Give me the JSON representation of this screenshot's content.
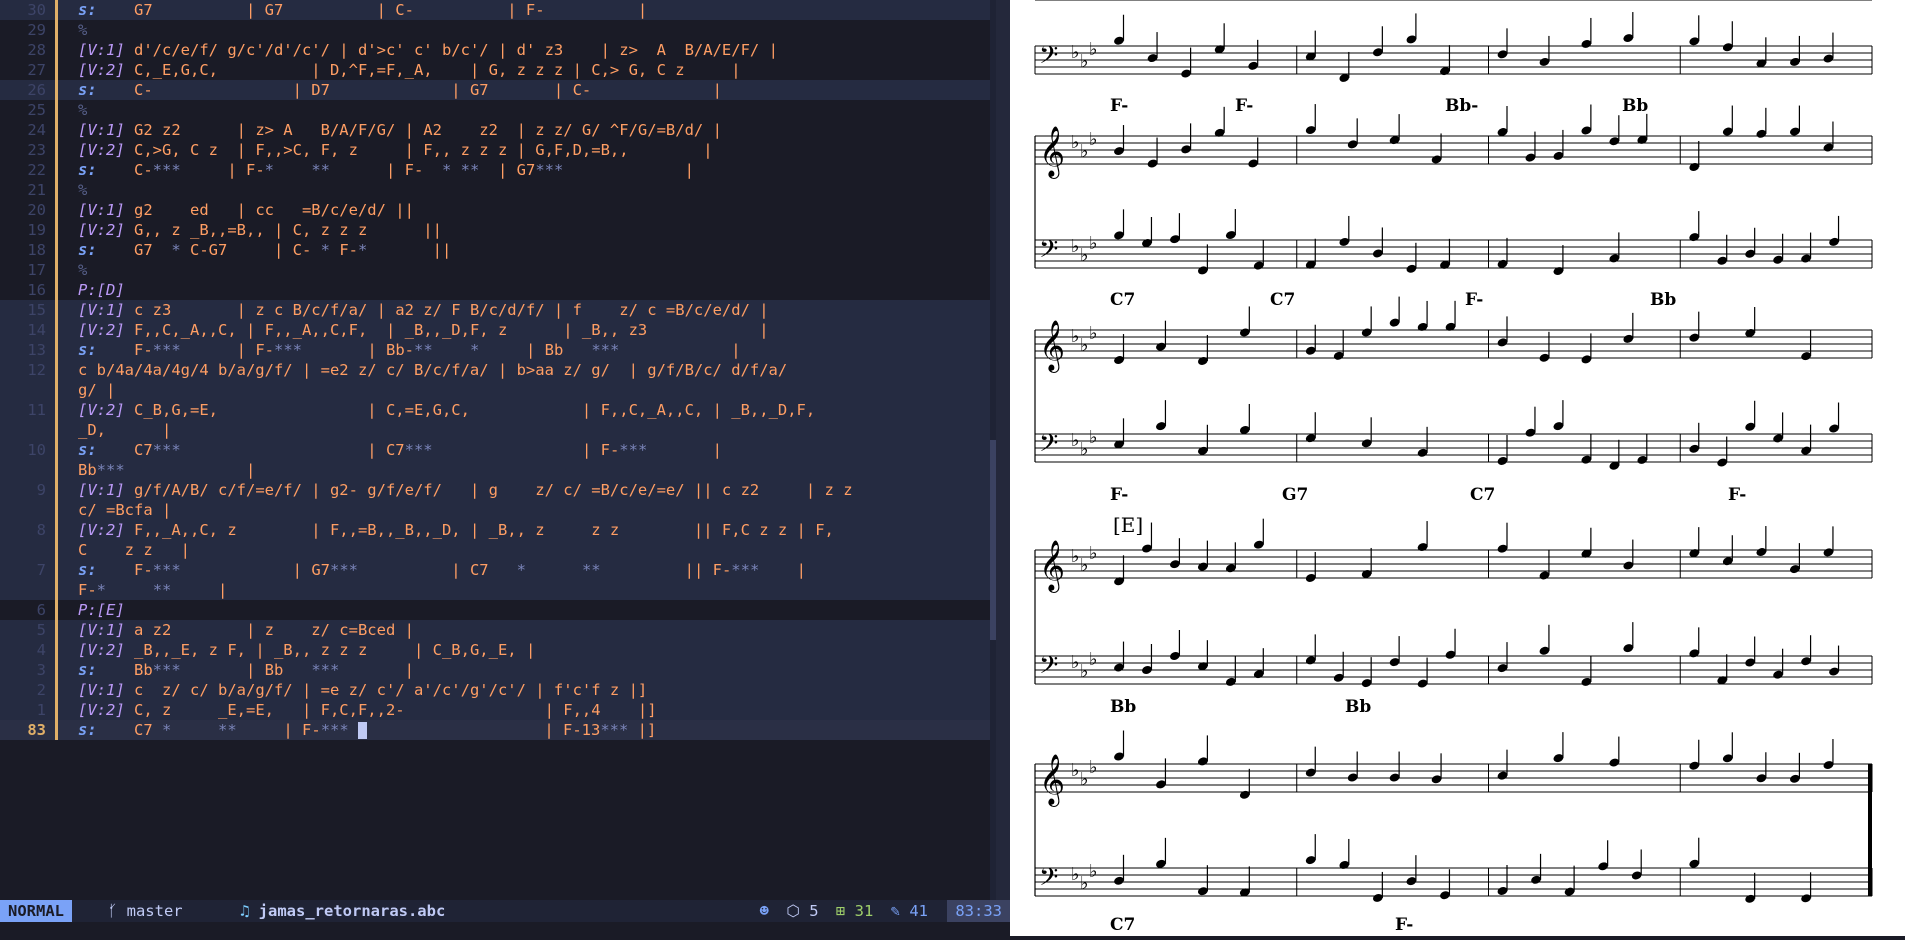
{
  "editor": {
    "lines": [
      {
        "num": "30",
        "hl": true,
        "parts": [
          [
            "s",
            "s:"
          ],
          [
            "n",
            "    G7          | G7          | C-          | F-          |"
          ]
        ]
      },
      {
        "num": "29",
        "hl": false,
        "parts": [
          [
            "c",
            "%"
          ]
        ]
      },
      {
        "num": "28",
        "hl": false,
        "parts": [
          [
            "v",
            "[V:1]"
          ],
          [
            "n",
            " d'/c/e/f/ g/c'/d'/c'/ | d'>c' c' b/c'/ | d' z3    | z>  A  B/A/E/F/ |"
          ]
        ]
      },
      {
        "num": "27",
        "hl": false,
        "parts": [
          [
            "v",
            "[V:2]"
          ],
          [
            "n",
            " C,_E,G,C,          | D,^F,=F,_A,    | G, z z z | C,> G, C z     |"
          ]
        ]
      },
      {
        "num": "26",
        "hl": true,
        "parts": [
          [
            "s",
            "s:"
          ],
          [
            "n",
            "    C-               | D7             | G7       | C-             |"
          ]
        ]
      },
      {
        "num": "25",
        "hl": false,
        "parts": [
          [
            "c",
            "%"
          ]
        ]
      },
      {
        "num": "24",
        "hl": false,
        "parts": [
          [
            "v",
            "[V:1]"
          ],
          [
            "n",
            " G2 z2      | z> A   B/A/F/G/ | A2    z2  | z z/ G/ ^F/G/=B/d/ |"
          ]
        ]
      },
      {
        "num": "23",
        "hl": false,
        "parts": [
          [
            "v",
            "[V:2]"
          ],
          [
            "n",
            " C,>G, C z  | F,,>C, F, z     | F,, z z z | G,F,D,=B,,        |"
          ]
        ]
      },
      {
        "num": "22",
        "hl": false,
        "parts": [
          [
            "s",
            "s:"
          ],
          [
            "n",
            "    C-"
          ],
          [
            "x",
            "***"
          ],
          [
            "n",
            "     | F-"
          ],
          [
            "x",
            "*"
          ],
          [
            "n",
            "    "
          ],
          [
            "x",
            "**"
          ],
          [
            "n",
            "      | F-  "
          ],
          [
            "x",
            "* **"
          ],
          [
            "n",
            "  | G7"
          ],
          [
            "x",
            "***"
          ],
          [
            "n",
            "             |"
          ]
        ]
      },
      {
        "num": "21",
        "hl": false,
        "parts": [
          [
            "c",
            "%"
          ]
        ]
      },
      {
        "num": "20",
        "hl": false,
        "parts": [
          [
            "v",
            "[V:1]"
          ],
          [
            "n",
            " g2    ed   | cc   =B/c/e/d/ ||"
          ]
        ]
      },
      {
        "num": "19",
        "hl": false,
        "parts": [
          [
            "v",
            "[V:2]"
          ],
          [
            "n",
            " G,, z _B,,=B,, | C, z z z      ||"
          ]
        ]
      },
      {
        "num": "18",
        "hl": false,
        "parts": [
          [
            "s",
            "s:"
          ],
          [
            "n",
            "    G7  "
          ],
          [
            "x",
            "*"
          ],
          [
            "n",
            " C-G7     | C- "
          ],
          [
            "x",
            "*"
          ],
          [
            "n",
            " F-"
          ],
          [
            "x",
            "*"
          ],
          [
            "n",
            "       ||"
          ]
        ]
      },
      {
        "num": "17",
        "hl": false,
        "parts": [
          [
            "c",
            "%"
          ]
        ]
      },
      {
        "num": "16",
        "hl": false,
        "parts": [
          [
            "p",
            "P:[D]"
          ]
        ]
      },
      {
        "num": "15",
        "hl": true,
        "parts": [
          [
            "v",
            "[V:1]"
          ],
          [
            "n",
            " c z3       | z c B/c/f/a/ | a2 z/ F B/c/d/f/ | f    z/ c =B/c/e/d/ |"
          ]
        ]
      },
      {
        "num": "14",
        "hl": true,
        "parts": [
          [
            "v",
            "[V:2]"
          ],
          [
            "n",
            " F,,C,_A,,C, | F,,_A,,C,F,  | _B,,_D,F, z      | _B,, z3            |"
          ]
        ]
      },
      {
        "num": "13",
        "hl": true,
        "parts": [
          [
            "s",
            "s:"
          ],
          [
            "n",
            "    F-"
          ],
          [
            "x",
            "***"
          ],
          [
            "n",
            "      | F-"
          ],
          [
            "x",
            "***"
          ],
          [
            "n",
            "       | Bb-"
          ],
          [
            "x",
            "**"
          ],
          [
            "n",
            "    "
          ],
          [
            "x",
            "*"
          ],
          [
            "n",
            "     | Bb   "
          ],
          [
            "x",
            "***"
          ],
          [
            "n",
            "            |"
          ]
        ]
      },
      {
        "num": "12",
        "hl": true,
        "parts": [
          [
            "n",
            "c b/4a/4a/4g/4 b/a/g/f/ | =e2 z/ c/ B/c/f/a/ | b>aa z/ g/  | g/f/B/c/ d/f/a/"
          ]
        ]
      },
      {
        "num": "",
        "hl": true,
        "parts": [
          [
            "n",
            "g/ |"
          ]
        ]
      },
      {
        "num": "11",
        "hl": true,
        "parts": [
          [
            "v",
            "[V:2]"
          ],
          [
            "n",
            " C_B,G,=E,                | C,=E,G,C,            | F,,C,_A,,C, | _B,,_D,F,"
          ]
        ]
      },
      {
        "num": "",
        "hl": true,
        "parts": [
          [
            "n",
            "_D,      |"
          ]
        ]
      },
      {
        "num": "10",
        "hl": true,
        "parts": [
          [
            "s",
            "s:"
          ],
          [
            "n",
            "    C7"
          ],
          [
            "x",
            "***"
          ],
          [
            "n",
            "                    | C7"
          ],
          [
            "x",
            "***"
          ],
          [
            "n",
            "                | F-"
          ],
          [
            "x",
            "***"
          ],
          [
            "n",
            "       |"
          ]
        ]
      },
      {
        "num": "",
        "hl": true,
        "parts": [
          [
            "n",
            "Bb"
          ],
          [
            "x",
            "***"
          ],
          [
            "n",
            "             |"
          ]
        ]
      },
      {
        "num": "9",
        "hl": true,
        "parts": [
          [
            "v",
            "[V:1]"
          ],
          [
            "n",
            " g/f/A/B/ c/f/=e/f/ | g2- g/f/e/f/   | g    z/ c/ =B/c/e/=e/ || c z2     | z z"
          ]
        ]
      },
      {
        "num": "",
        "hl": true,
        "parts": [
          [
            "n",
            "c/ =Bcfa |"
          ]
        ]
      },
      {
        "num": "8",
        "hl": true,
        "parts": [
          [
            "v",
            "[V:2]"
          ],
          [
            "n",
            " F,,_A,,C, z        | F,,=B,,_B,,_D, | _B,, z     z z        || F,C z z | F,"
          ]
        ]
      },
      {
        "num": "",
        "hl": true,
        "parts": [
          [
            "n",
            "C    z z   |"
          ]
        ]
      },
      {
        "num": "7",
        "hl": true,
        "parts": [
          [
            "s",
            "s:"
          ],
          [
            "n",
            "    F-"
          ],
          [
            "x",
            "***"
          ],
          [
            "n",
            "            | G7"
          ],
          [
            "x",
            "***"
          ],
          [
            "n",
            "          | C7   "
          ],
          [
            "x",
            "*"
          ],
          [
            "n",
            "      "
          ],
          [
            "x",
            "**"
          ],
          [
            "n",
            "         || F-"
          ],
          [
            "x",
            "***"
          ],
          [
            "n",
            "    |"
          ]
        ]
      },
      {
        "num": "",
        "hl": true,
        "parts": [
          [
            "n",
            "F-"
          ],
          [
            "x",
            "*"
          ],
          [
            "n",
            "     "
          ],
          [
            "x",
            "**"
          ],
          [
            "n",
            "     |"
          ]
        ]
      },
      {
        "num": "6",
        "hl": false,
        "parts": [
          [
            "p",
            "P:[E]"
          ]
        ]
      },
      {
        "num": "5",
        "hl": true,
        "parts": [
          [
            "v",
            "[V:1]"
          ],
          [
            "n",
            " a z2        | z    z/ c=Bced |"
          ]
        ]
      },
      {
        "num": "4",
        "hl": true,
        "parts": [
          [
            "v",
            "[V:2]"
          ],
          [
            "n",
            " _B,,_E, z F, | _B,, z z z     | C_B,G,_E, |"
          ]
        ]
      },
      {
        "num": "3",
        "hl": true,
        "parts": [
          [
            "s",
            "s:"
          ],
          [
            "n",
            "    Bb"
          ],
          [
            "x",
            "***"
          ],
          [
            "n",
            "       | Bb   "
          ],
          [
            "x",
            "***"
          ],
          [
            "n",
            "       |"
          ]
        ]
      },
      {
        "num": "2",
        "hl": true,
        "parts": [
          [
            "v",
            "[V:1]"
          ],
          [
            "n",
            " c  z/ c/ b/a/g/f/ | =e z/ c'/ a'/c'/g'/c'/ | f'c'f z |]"
          ]
        ]
      },
      {
        "num": "1",
        "hl": true,
        "parts": [
          [
            "v",
            "[V:2]"
          ],
          [
            "n",
            " C, z     _E,=E,   | F,C,F,,2-               | F,,4    |]"
          ]
        ]
      },
      {
        "num": "83",
        "hl": true,
        "cur": true,
        "parts": [
          [
            "s",
            "s:"
          ],
          [
            "n",
            "    C7 "
          ],
          [
            "x",
            "*"
          ],
          [
            "n",
            "     "
          ],
          [
            "x",
            "**"
          ],
          [
            "n",
            "     | F-"
          ],
          [
            "x",
            "***"
          ],
          [
            "n",
            " "
          ],
          [
            "k",
            ""
          ],
          [
            "n",
            "                   | F-13"
          ],
          [
            "x",
            "***"
          ],
          [
            "n",
            " |]"
          ]
        ]
      }
    ]
  },
  "statusline": {
    "mode": "NORMAL",
    "branch_icon": "git-branch-icon",
    "branch": "master",
    "file_icon": "music-note-icon",
    "filename": "jamas_retornaras.abc",
    "copilot_icon": "copilot-icon",
    "lsp_icon": "cube-icon",
    "lsp_count": "5",
    "added_icon": "diff-added-icon",
    "added": "31",
    "modified_icon": "diff-modified-icon",
    "modified": "41",
    "position": "83:33"
  },
  "sheet": {
    "rows": [
      {
        "chords": [
          "F-",
          "F-",
          "Bb-",
          "Bb"
        ]
      },
      {
        "chords": [
          "C7",
          "C7",
          "F-",
          "Bb"
        ]
      },
      {
        "chords": [
          "F-",
          "G7",
          "C7",
          "F-"
        ]
      },
      {
        "rehearsal": "[E]",
        "chords": [
          "Bb",
          "Bb"
        ]
      },
      {
        "chords": [
          "C7",
          "F-"
        ]
      }
    ]
  },
  "colors": {
    "background": "#1a1b26",
    "highlight": "#252b41",
    "note_text": "#ff9e64",
    "keyword": "#7aa2f7",
    "voice": "#bb9af7",
    "mode_bg": "#7aa2f7"
  }
}
